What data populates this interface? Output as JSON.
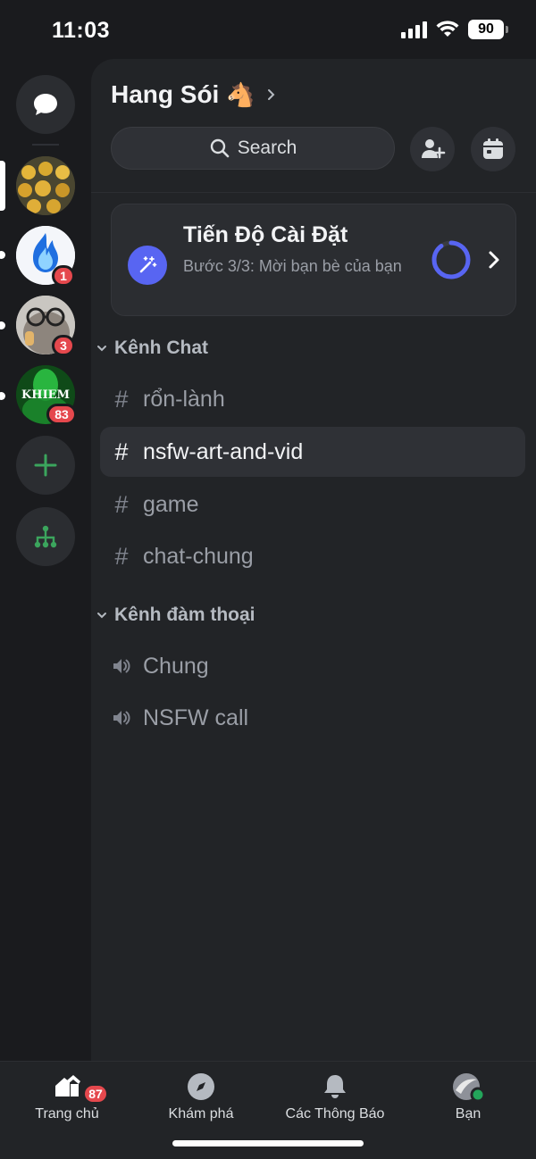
{
  "status_bar": {
    "time": "11:03",
    "battery": "90"
  },
  "server": {
    "name": "Hang Sói",
    "emoji": "🐴"
  },
  "search": {
    "label": "Search"
  },
  "colors": {
    "accent": "#5865f2",
    "badge": "#e5484d",
    "panel": "#222427",
    "rail": "#1a1b1e"
  },
  "rail": {
    "servers": [
      {
        "name": "server-yellow-items",
        "mention": null
      },
      {
        "name": "server-blue-fire",
        "mention": "1"
      },
      {
        "name": "server-glasses-face",
        "mention": "3"
      },
      {
        "name": "server-khiem",
        "mention": "83",
        "text": "KHIEM"
      }
    ]
  },
  "progress_card": {
    "title": "Tiến Độ Cài Đặt",
    "subtitle": "Bước 3/3: Mời bạn bè của bạn",
    "progress": 0.9
  },
  "categories": [
    {
      "label": "Kênh Chat",
      "channels": [
        {
          "name": "rổn-lành",
          "type": "text"
        },
        {
          "name": "nsfw-art-and-vid",
          "type": "text",
          "active": true
        },
        {
          "name": "game",
          "type": "text"
        },
        {
          "name": "chat-chung",
          "type": "text"
        }
      ]
    },
    {
      "label": "Kênh đàm thoại",
      "channels": [
        {
          "name": "Chung",
          "type": "voice"
        },
        {
          "name": "NSFW call",
          "type": "voice"
        }
      ]
    }
  ],
  "nav": {
    "items": [
      {
        "label": "Trang chủ",
        "icon": "home-icon",
        "badge": "87"
      },
      {
        "label": "Khám phá",
        "icon": "compass-icon"
      },
      {
        "label": "Các Thông Báo",
        "icon": "bell-icon"
      },
      {
        "label": "Bạn",
        "icon": "avatar-icon"
      }
    ]
  }
}
